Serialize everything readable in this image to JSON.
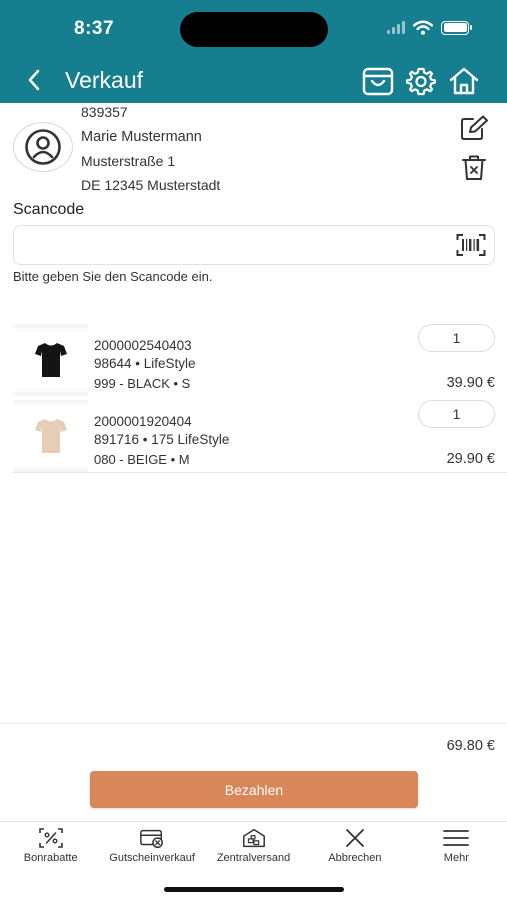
{
  "status_bar": {
    "time": "8:37"
  },
  "header": {
    "title": "Verkauf",
    "icons": [
      "back-chevron-icon",
      "basket-icon",
      "gear-icon",
      "home-icon"
    ]
  },
  "customer": {
    "id": "839357",
    "name": "Marie Mustermann",
    "street": "Musterstraße 1",
    "city": "DE 12345 Musterstadt"
  },
  "scan": {
    "label": "Scancode",
    "value": "",
    "placeholder": "",
    "hint": "Bitte geben Sie den Scancode ein."
  },
  "cart": {
    "items": [
      {
        "ean": "2000002540403",
        "article": "98644 • LifeStyle",
        "variant": "999 - BLACK • S",
        "quantity": "1",
        "price": "39.90 €",
        "image_color": "#141414"
      },
      {
        "ean": "2000001920404",
        "article": "891716 • 175 LifeStyle",
        "variant": "080 - BEIGE • M",
        "quantity": "1",
        "price": "29.90 €",
        "image_color": "#e6cdb8"
      }
    ],
    "total": "69.80 €"
  },
  "actions": {
    "pay_label": "Bezahlen",
    "pay_color": "#d9865a"
  },
  "tabbar": {
    "tabs": [
      {
        "label": "Bonrabatte",
        "icon": "percent-scan-icon"
      },
      {
        "label": "Gutscheinverkauf",
        "icon": "voucher-icon"
      },
      {
        "label": "Zentralversand",
        "icon": "warehouse-icon"
      },
      {
        "label": "Abbrechen",
        "icon": "close-icon"
      },
      {
        "label": "Mehr",
        "icon": "menu-icon"
      }
    ]
  },
  "colors": {
    "brand": "#167f8f",
    "accent": "#d9865a"
  }
}
